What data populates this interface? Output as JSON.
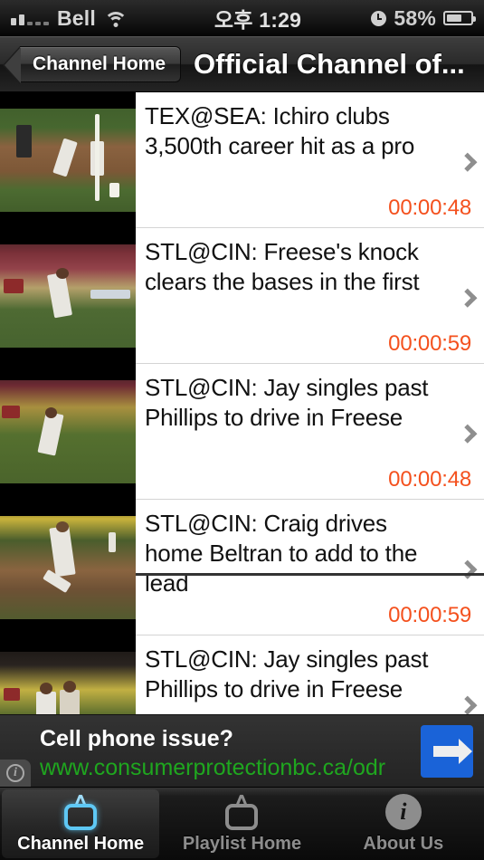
{
  "status_bar": {
    "carrier": "Bell",
    "time": "오후 1:29",
    "battery_percent": "58%",
    "signal_bars_filled": 2,
    "signal_bars_total": 5
  },
  "nav_bar": {
    "back_label": "Channel Home",
    "title": "Official Channel of..."
  },
  "list": {
    "items": [
      {
        "title": "TEX@SEA: Ichiro clubs 3,500th career hit as a pro",
        "duration": "00:00:48"
      },
      {
        "title": "STL@CIN: Freese's knock clears the bases in the first",
        "duration": "00:00:59"
      },
      {
        "title": "STL@CIN: Jay singles past Phillips to drive in Freese",
        "duration": "00:00:48"
      },
      {
        "title": "STL@CIN: Craig drives home Beltran to add to the lead",
        "duration": "00:00:59"
      },
      {
        "title": "STL@CIN: Jay singles past Phillips to drive in Freese",
        "duration": ""
      }
    ]
  },
  "ad": {
    "headline": "Cell phone issue?",
    "url": "www.consumerprotectionbc.ca/odr",
    "info_glyph": "i"
  },
  "tab_bar": {
    "tabs": [
      {
        "label": "Channel Home",
        "icon": "tv-icon",
        "active": true
      },
      {
        "label": "Playlist Home",
        "icon": "tv-icon",
        "active": false
      },
      {
        "label": "About Us",
        "icon": "info-icon",
        "active": false
      }
    ],
    "about_glyph": "i"
  },
  "colors": {
    "duration_orange": "#f4511e",
    "ad_url_green": "#1fa71f",
    "ad_button_blue": "#1a63d8",
    "active_tab_blue": "#5ec8f5"
  }
}
